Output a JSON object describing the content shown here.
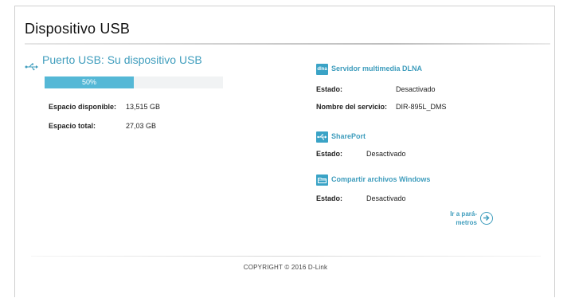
{
  "page": {
    "title": "Dispositivo USB"
  },
  "usb": {
    "title": "Puerto USB: Su dispositivo USB",
    "progress": {
      "percent": 50,
      "label": "50%"
    },
    "available_label": "Espacio disponible:",
    "available_value": "13,515 GB",
    "total_label": "Espacio total:",
    "total_value": "27,03 GB"
  },
  "services": {
    "dlna": {
      "icon": "dlna-icon",
      "icon_text": "dlna",
      "title": "Servidor multimedia DLNA",
      "status_label": "Estado:",
      "status_value": "Desactivado",
      "name_label": "Nombre del servicio:",
      "name_value": "DIR-895L_DMS"
    },
    "shareport": {
      "icon": "usb-icon",
      "title": "SharePort",
      "status_label": "Estado:",
      "status_value": "Desactivado"
    },
    "windows": {
      "icon": "folder-icon",
      "title": "Compartir archivos Windows",
      "status_label": "Estado:",
      "status_value": "Desactivado"
    }
  },
  "goto": {
    "line1": "Ir a pará-",
    "line2": "metros",
    "icon": "arrow-right-circle-icon"
  },
  "footer": {
    "copyright": "COPYRIGHT © 2016 D-Link"
  },
  "colors": {
    "accent": "#3f9dbd",
    "progress_fill": "#55b8d6",
    "progress_track": "#f1f3f4"
  }
}
